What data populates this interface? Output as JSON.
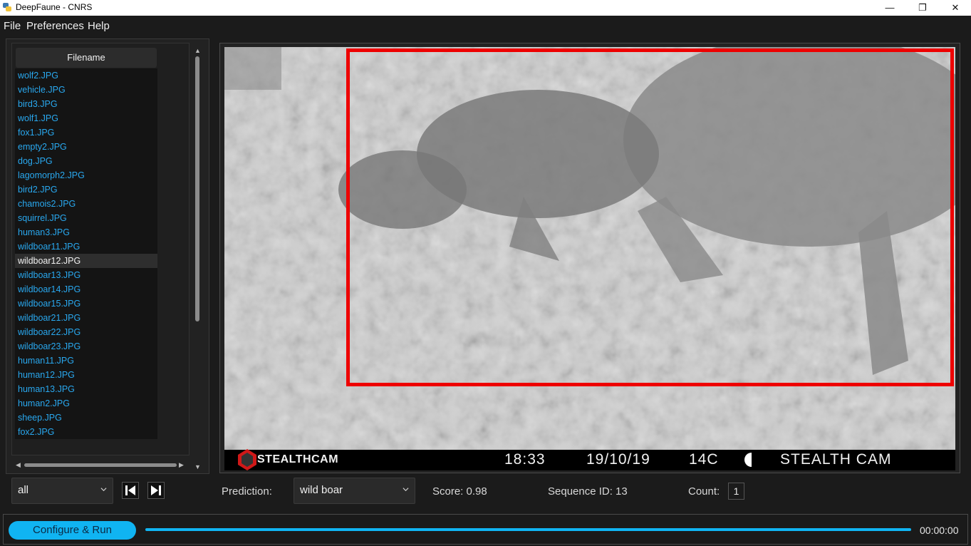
{
  "window": {
    "title": "DeepFaune - CNRS",
    "minimize": "—",
    "restore": "❐",
    "close": "✕"
  },
  "menu": [
    "File",
    "Preferences",
    "Help"
  ],
  "file_table": {
    "header": "Filename",
    "selected_index": 13,
    "files": [
      "wolf2.JPG",
      "vehicle.JPG",
      "bird3.JPG",
      "wolf1.JPG",
      "fox1.JPG",
      "empty2.JPG",
      "dog.JPG",
      "lagomorph2.JPG",
      "bird2.JPG",
      "chamois2.JPG",
      "squirrel.JPG",
      "human3.JPG",
      "wildboar11.JPG",
      "wildboar12.JPG",
      "wildboar13.JPG",
      "wildboar14.JPG",
      "wildboar15.JPG",
      "wildboar21.JPG",
      "wildboar22.JPG",
      "wildboar23.JPG",
      "human11.JPG",
      "human12.JPG",
      "human13.JPG",
      "human2.JPG",
      "sheep.JPG",
      "fox2.JPG"
    ]
  },
  "filter": {
    "value": "all"
  },
  "image": {
    "caption": {
      "brand": "STEALTHCAM",
      "time": "18:33",
      "date": "19/10/19",
      "temp": "14C",
      "camera": "STEALTH CAM"
    }
  },
  "prediction": {
    "label": "Prediction:",
    "value": "wild boar"
  },
  "score": {
    "text": "Score: 0.98"
  },
  "sequence": {
    "text": "Sequence ID: 13"
  },
  "count": {
    "label": "Count:",
    "value": "1"
  },
  "run": {
    "label": "Configure & Run",
    "progress": 1.0,
    "time": "00:00:00"
  },
  "colors": {
    "accent": "#10b4f2",
    "file_link": "#29a8ef",
    "bbox": "#ee0000"
  }
}
